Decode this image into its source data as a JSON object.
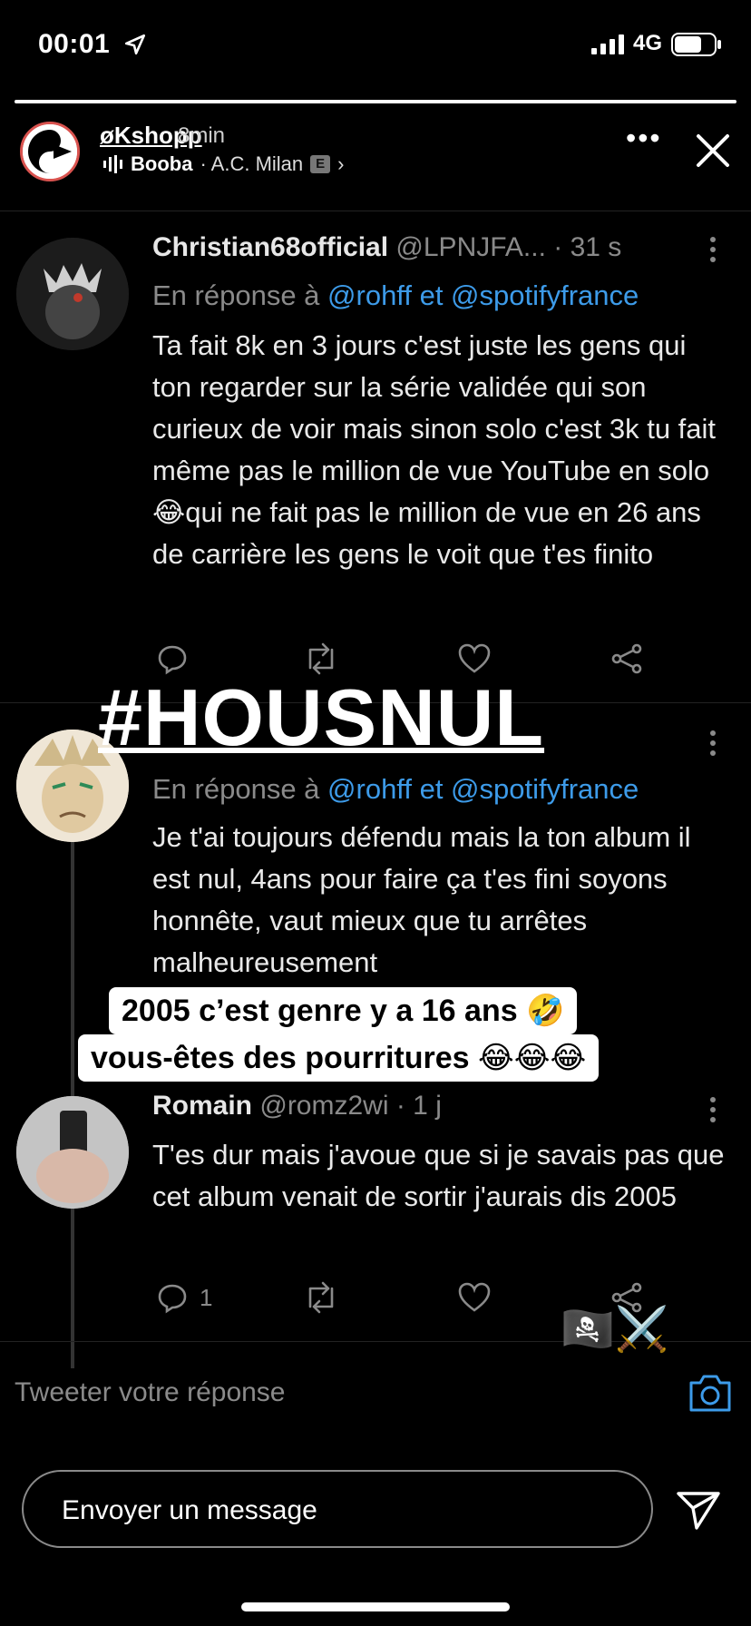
{
  "status_bar": {
    "time": "00:01",
    "network": "4G",
    "battery_level": 0.7
  },
  "story": {
    "progress": 1.0,
    "username": "øKshopp",
    "time_ago": "8min",
    "music_artist": "Booba",
    "music_song": "· A.C. Milan",
    "explicit_badge": "E",
    "chevron": "›",
    "more_dots": "•••"
  },
  "tweets": [
    {
      "name": "Christian68official",
      "handle": "@LPNJFA...",
      "time": " · 31 s",
      "reply_prefix": "En réponse à ",
      "reply_mentions": "@rohff et @spotifyfrance",
      "body": "Ta fait 8k en 3 jours c'est juste les gens qui ton regarder sur la série validée qui son curieux de voir mais sinon solo c'est 3k tu fait même pas le million de vue YouTube en solo 😂qui ne fait pas le million de vue en 26 ans de carrière les gens le voit que t'es finito",
      "reply_count": ""
    },
    {
      "name": "",
      "handle": "",
      "time": "",
      "reply_prefix": "En réponse à ",
      "reply_mentions": "@rohff et @spotifyfrance",
      "body": "Je t'ai toujours défendu mais la ton album il est nul, 4ans pour faire ça t'es fini soyons honnête, vaut mieux que tu arrêtes malheureusement",
      "reply_count": ""
    },
    {
      "name": "Romain",
      "handle": " @romz2wi",
      "time": " · 1 j",
      "reply_prefix": "",
      "reply_mentions": "",
      "body": "T'es dur mais j'avoue que si je savais pas que cet album venait de sortir j'aurais dis 2005",
      "reply_count": "1"
    }
  ],
  "overlays": {
    "hashtag": "#HOUSNUL",
    "caption_line1": "2005 c’est genre y a 16 ans 🤣",
    "caption_line2": "vous-êtes des pourritures 😂😂😂",
    "stickers": "🏴‍☠️⚔️"
  },
  "reply_field": {
    "placeholder": "Tweeter votre réponse"
  },
  "message_bar": {
    "placeholder": "Envoyer un message"
  }
}
